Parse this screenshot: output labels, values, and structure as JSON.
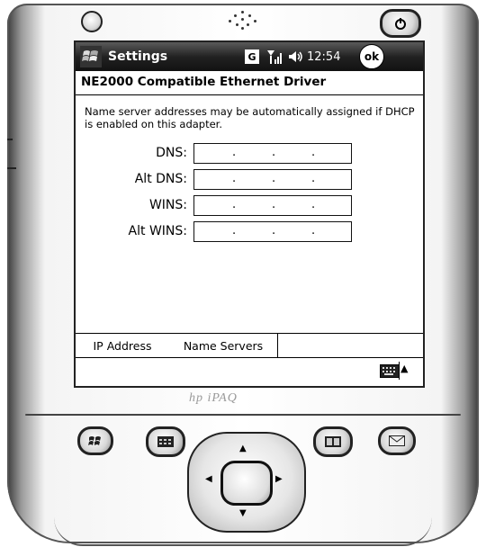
{
  "status_bar": {
    "app_title": "Settings",
    "network_badge": "G",
    "clock": "12:54",
    "ok_label": "ok"
  },
  "page": {
    "heading": "NE2000 Compatible Ethernet Driver",
    "description": "Name server addresses may be automatically assigned if DHCP is enabled on this adapter."
  },
  "fields": [
    {
      "label": "DNS:",
      "value": ""
    },
    {
      "label": "Alt DNS:",
      "value": ""
    },
    {
      "label": "WINS:",
      "value": ""
    },
    {
      "label": "Alt WINS:",
      "value": ""
    }
  ],
  "tabs": [
    {
      "label": "IP Address",
      "active": false
    },
    {
      "label": "Name Servers",
      "active": true
    }
  ],
  "icons": {
    "start": "windows-flag-icon",
    "signal": "signal-strength-icon",
    "volume": "speaker-icon",
    "keyboard": "keyboard-icon",
    "hw_buttons": [
      "windows-button-icon",
      "calendar-icon",
      "contacts-icon",
      "mail-icon"
    ]
  }
}
